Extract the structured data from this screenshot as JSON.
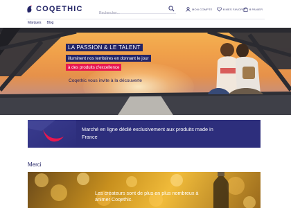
{
  "header": {
    "logo_text": "COQETHIC",
    "search_placeholder": "Rechercher...",
    "links": [
      {
        "label": "MON COMPTE",
        "count": ""
      },
      {
        "label": "MES FAVORIS",
        "count": "0"
      },
      {
        "label": "PANIER",
        "count": "0"
      }
    ]
  },
  "nav": {
    "items": [
      "Marques",
      "Blog"
    ]
  },
  "hero": {
    "title": "LA PASSION & LE TALENT",
    "line2": "illuminent nos territoires en donnant le jour",
    "line3": "à des produits d'excellence",
    "subtitle": "Coqethic vous invite à la découverte"
  },
  "banner": {
    "text": "Marché en ligne dédié exclusivement aux produits made in France"
  },
  "section": {
    "title": "Merci",
    "card_text": "Les créateurs sont de plus en plus nombreux à animer Coqethic."
  },
  "colors": {
    "navy": "#232466",
    "accent_red": "#e8174f",
    "banner_bg": "#2d2e7c"
  }
}
